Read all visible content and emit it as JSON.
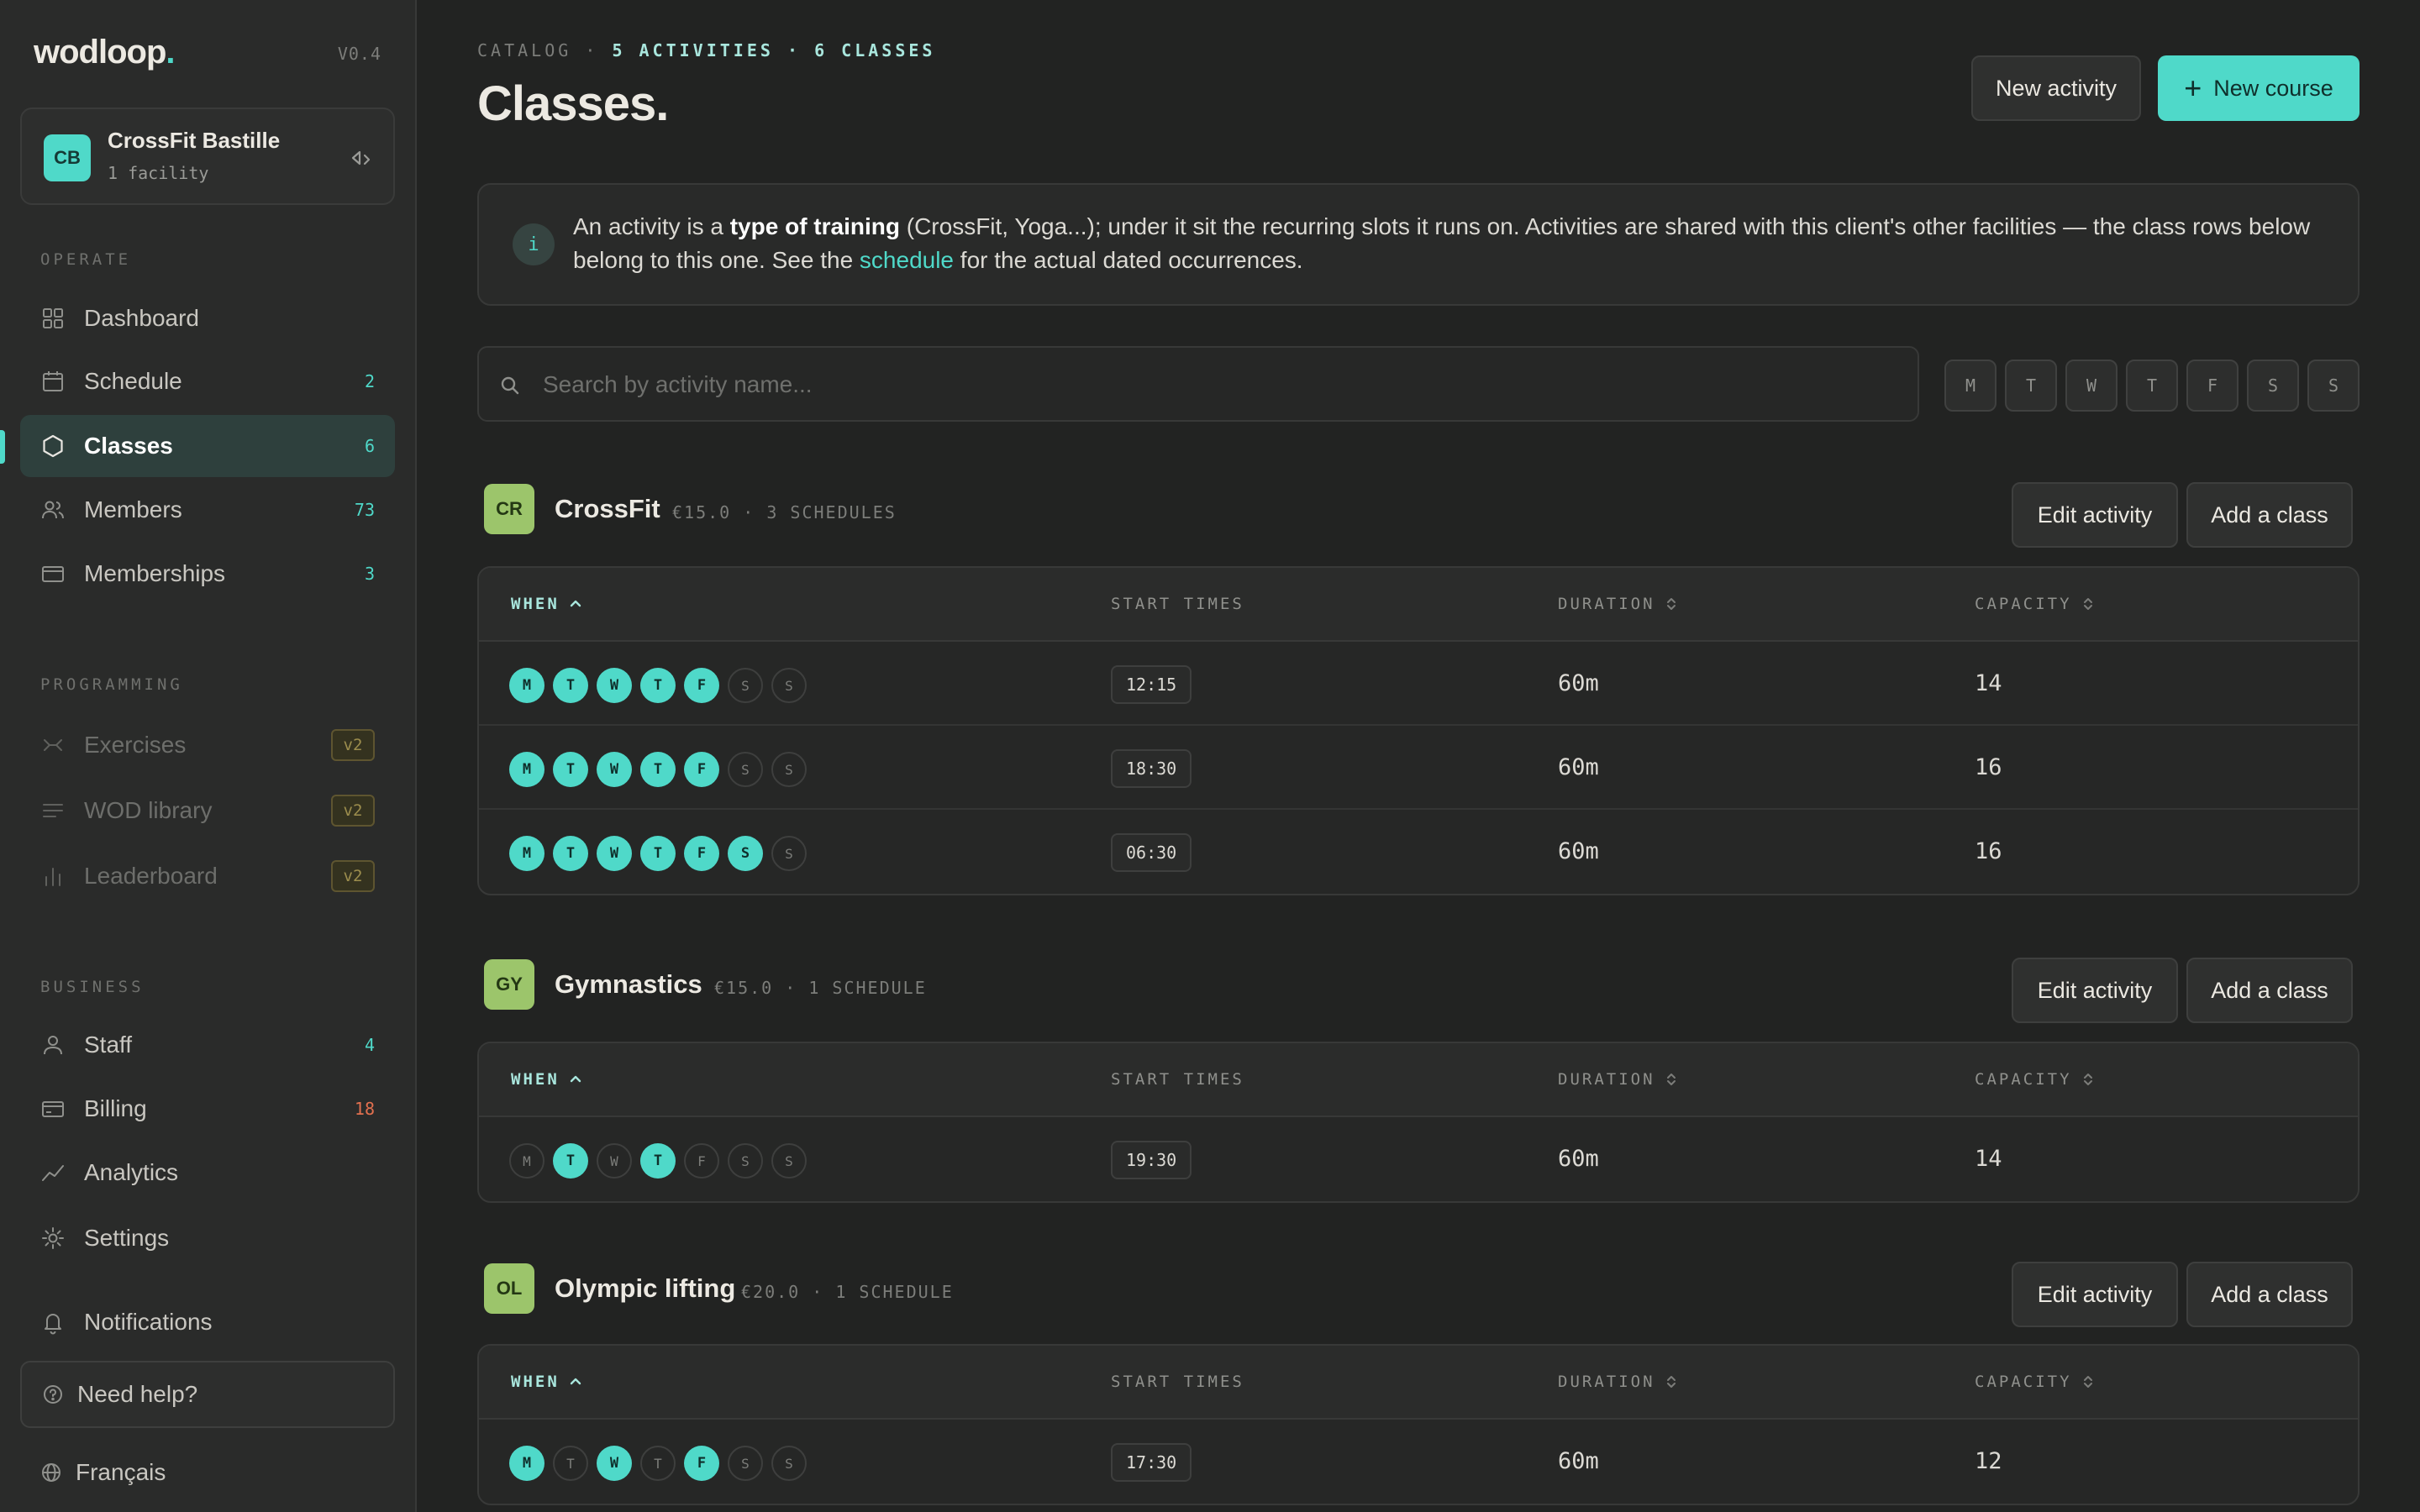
{
  "sidebar": {
    "brand": "wodloop",
    "brand_dot": ".",
    "version": "V0.4",
    "facility": {
      "initials": "CB",
      "name": "CrossFit Bastille",
      "sub": "1 facility"
    },
    "sections": {
      "operate": "OPERATE",
      "programming": "PROGRAMMING",
      "business": "BUSINESS"
    },
    "operate_items": [
      {
        "label": "Dashboard",
        "count": "",
        "icon": "grid-icon"
      },
      {
        "label": "Schedule",
        "count": "2",
        "icon": "calendar-icon"
      },
      {
        "label": "Classes",
        "count": "6",
        "icon": "hexagon-icon",
        "active": true
      },
      {
        "label": "Members",
        "count": "73",
        "icon": "users-icon"
      },
      {
        "label": "Memberships",
        "count": "3",
        "icon": "card-icon"
      }
    ],
    "programming_items": [
      {
        "label": "Exercises",
        "badge": "v2",
        "icon": "dumbbell-icon"
      },
      {
        "label": "WOD library",
        "badge": "v2",
        "icon": "list-icon"
      },
      {
        "label": "Leaderboard",
        "badge": "v2",
        "icon": "bar-chart-icon"
      }
    ],
    "business_items": [
      {
        "label": "Staff",
        "count": "4",
        "icon": "user-icon"
      },
      {
        "label": "Billing",
        "count": "18",
        "icon": "billing-icon"
      },
      {
        "label": "Analytics",
        "count": "",
        "icon": "trend-icon"
      },
      {
        "label": "Settings",
        "count": "",
        "icon": "gear-icon"
      }
    ],
    "notifications": "Notifications",
    "help": "Need help?",
    "language": "Français"
  },
  "colors": {
    "accent": "#4fd9c9",
    "danger": "#e2704f",
    "activity_avatar": "#9cc56b"
  },
  "header": {
    "crumb_root": "CATALOG",
    "crumb_sep": "·",
    "crumb_activities": "5 ACTIVITIES",
    "crumb_classes": "6 CLASSES",
    "title": "Classes.",
    "new_activity": "New activity",
    "new_course": "New course"
  },
  "info": {
    "icon_text": "i",
    "part1": "An activity is a ",
    "bold": "type of training",
    "part2": " (CrossFit, Yoga...); under it sit the recurring slots it runs on. Activities are shared with this client's other facilities — the class rows below belong to this one. See the ",
    "link": "schedule",
    "part3": " for the actual dated occurrences."
  },
  "search": {
    "placeholder": "Search by activity name..."
  },
  "day_filters": [
    "M",
    "T",
    "W",
    "T",
    "F",
    "S",
    "S"
  ],
  "table_headers": {
    "when": "WHEN",
    "start": "START TIMES",
    "duration": "DURATION",
    "capacity": "CAPACITY"
  },
  "activity_actions": {
    "edit": "Edit activity",
    "add": "Add a class"
  },
  "activities": [
    {
      "initials": "CR",
      "name": "CrossFit",
      "meta": "€15.0 · 3 SCHEDULES",
      "rows": [
        {
          "days": [
            1,
            1,
            1,
            1,
            1,
            0,
            0
          ],
          "time": "12:15",
          "duration": "60m",
          "capacity": "14"
        },
        {
          "days": [
            1,
            1,
            1,
            1,
            1,
            0,
            0
          ],
          "time": "18:30",
          "duration": "60m",
          "capacity": "16"
        },
        {
          "days": [
            1,
            1,
            1,
            1,
            1,
            1,
            0
          ],
          "time": "06:30",
          "duration": "60m",
          "capacity": "16"
        }
      ]
    },
    {
      "initials": "GY",
      "name": "Gymnastics",
      "meta": "€15.0 · 1 SCHEDULE",
      "rows": [
        {
          "days": [
            0,
            1,
            0,
            1,
            0,
            0,
            0
          ],
          "time": "19:30",
          "duration": "60m",
          "capacity": "14"
        }
      ]
    },
    {
      "initials": "OL",
      "name": "Olympic lifting",
      "meta": "€20.0 · 1 SCHEDULE",
      "rows": [
        {
          "days": [
            1,
            0,
            1,
            0,
            1,
            0,
            0
          ],
          "time": "17:30",
          "duration": "60m",
          "capacity": "12"
        }
      ]
    }
  ]
}
